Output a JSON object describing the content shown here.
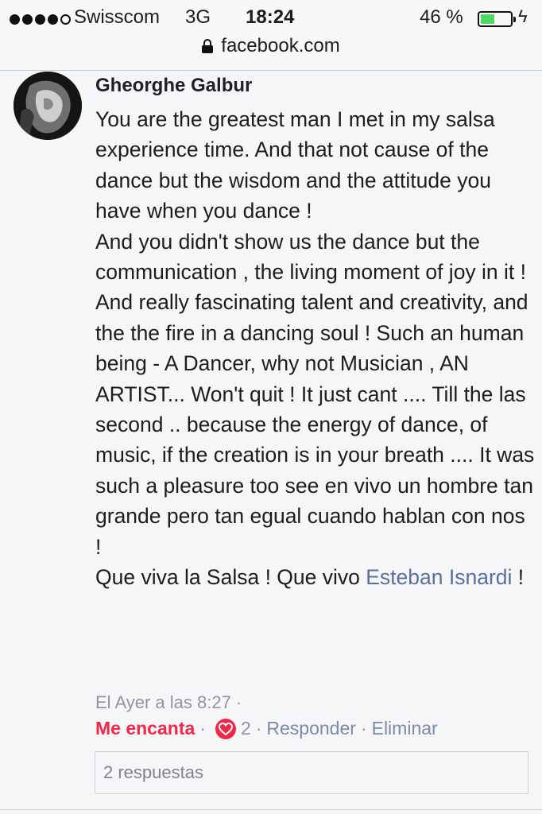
{
  "status_bar": {
    "carrier": "Swisscom",
    "network": "3G",
    "time": "18:24",
    "battery_percent": "46 %",
    "battery_level": 0.46,
    "signal_bars_filled": 4,
    "signal_bars_total": 5,
    "icons": [
      "signal-dots-icon",
      "lock-icon",
      "battery-icon",
      "charging-bolt-icon"
    ]
  },
  "address_bar": {
    "url": "facebook.com"
  },
  "comment": {
    "author": "Gheorghe Galbur",
    "text_before_mention": "You are the greatest man I met in my salsa experience time. And that not cause of the dance but the wisdom and the attitude you have when you dance !\nAnd you didn't show us the dance but the communication , the living moment of joy in it !\nAnd really fascinating talent and creativity, and the the fire in a dancing soul ! Such an human being - A Dancer, why not Musician , AN ARTIST... Won't quit ! It just cant .... Till the las second .. because the energy of dance, of music, if the creation is in your breath .... It was such a pleasure too see en vivo un hombre tan grande pero tan egual cuando hablan con nos !\nQue viva la Salsa ! Que vivo ",
    "mention": "Esteban Isnardi",
    "text_after_mention": " !",
    "timestamp": "El Ayer a las 8:27 ·",
    "reaction_label": "Me encanta",
    "reaction_count": "2",
    "reply_label": "Responder",
    "delete_label": "Eliminar",
    "separator": "·",
    "replies": "2 respuestas"
  },
  "colors": {
    "love": "#f0284a",
    "mention": "#5b6f9c",
    "meta": "#90949c",
    "battery": "#4cd964"
  }
}
